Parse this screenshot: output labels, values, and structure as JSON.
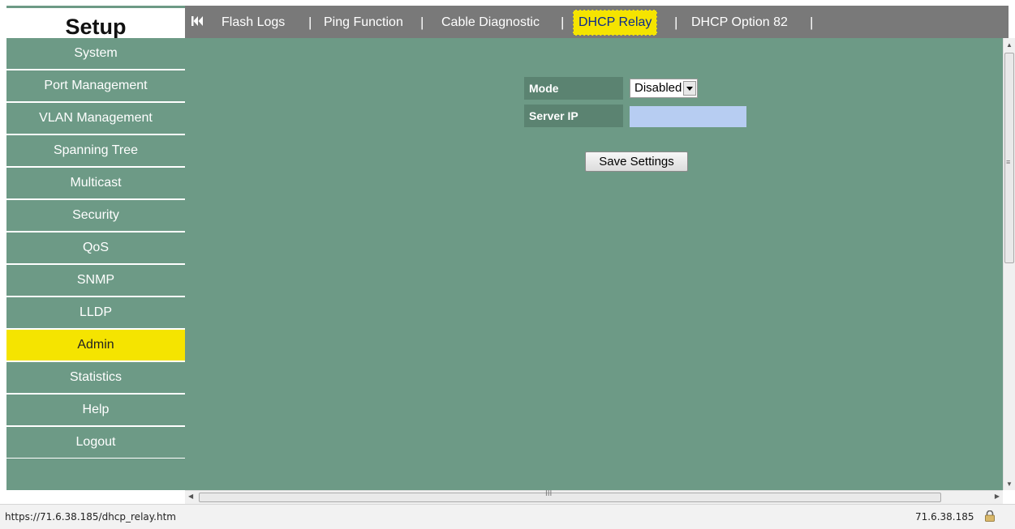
{
  "sidebar": {
    "title": "Setup",
    "items": [
      {
        "label": "System",
        "active": false
      },
      {
        "label": "Port Management",
        "active": false
      },
      {
        "label": "VLAN Management",
        "active": false
      },
      {
        "label": "Spanning Tree",
        "active": false
      },
      {
        "label": "Multicast",
        "active": false
      },
      {
        "label": "Security",
        "active": false
      },
      {
        "label": "QoS",
        "active": false
      },
      {
        "label": "SNMP",
        "active": false
      },
      {
        "label": "LLDP",
        "active": false
      },
      {
        "label": "Admin",
        "active": true
      },
      {
        "label": "Statistics",
        "active": false
      },
      {
        "label": "Help",
        "active": false
      },
      {
        "label": "Logout",
        "active": false
      }
    ]
  },
  "tabs": {
    "first_icon": "skip-to-first-icon",
    "items": [
      {
        "label": "Flash Logs"
      },
      {
        "label": "Ping Function"
      },
      {
        "label": "Cable Diagnostic"
      },
      {
        "label": "DHCP Relay",
        "active": true
      },
      {
        "label": "DHCP Option 82"
      }
    ],
    "separator": "|"
  },
  "form": {
    "mode_label": "Mode",
    "mode_value": "Disabled",
    "server_ip_label": "Server IP",
    "server_ip_value": "",
    "save_label": "Save Settings"
  },
  "statusbar": {
    "url": "https://71.6.38.185/dhcp_relay.htm",
    "host": "71.6.38.185",
    "icon": "lock-icon"
  },
  "colors": {
    "nav_green": "#6d9a86",
    "label_green": "#5b8371",
    "active_yellow": "#f5e400",
    "tabbar_gray": "#797979",
    "input_blue": "#b7cdf2"
  }
}
